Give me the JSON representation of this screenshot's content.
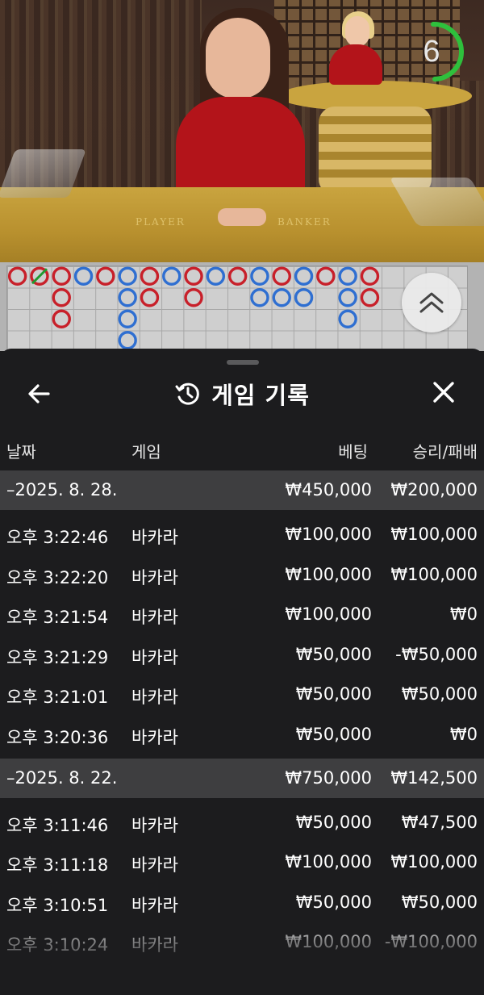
{
  "video": {
    "timer_value": "6",
    "table_labels": [
      "PLAYER",
      "BANKER"
    ]
  },
  "bead_road": {
    "colors": {
      "banker": "#c8202a",
      "player": "#2f6fd1",
      "tie": "#1f9a2f"
    },
    "columns": [
      [
        "banker"
      ],
      [
        "banker-tie"
      ],
      [
        "banker",
        "banker",
        "banker"
      ],
      [
        "player"
      ],
      [
        "banker"
      ],
      [
        "player",
        "player",
        "player",
        "player"
      ],
      [
        "banker",
        "banker"
      ],
      [
        "player"
      ],
      [
        "banker",
        "banker"
      ],
      [
        "player"
      ],
      [
        "banker"
      ],
      [
        "player",
        "player"
      ],
      [
        "banker",
        "player"
      ],
      [
        "player",
        "player"
      ],
      [
        "banker"
      ],
      [
        "player",
        "player",
        "player"
      ],
      [
        "banker",
        "banker"
      ]
    ]
  },
  "sheet": {
    "title": "게임 기록",
    "icons": {
      "back": "arrow-left-icon",
      "history": "history-clock-icon",
      "close": "close-icon",
      "expand": "chevron-double-up-icon"
    },
    "columns": {
      "date": "날짜",
      "game": "게임",
      "bet": "베팅",
      "result": "승리/패배"
    },
    "groups": [
      {
        "date": "–2025. 8. 28.",
        "total_bet": "₩450,000",
        "total_result": "₩200,000",
        "rows": [
          {
            "time": "오후 3:22:46",
            "game": "바카라",
            "bet": "₩100,000",
            "result": "₩100,000"
          },
          {
            "time": "오후 3:22:20",
            "game": "바카라",
            "bet": "₩100,000",
            "result": "₩100,000"
          },
          {
            "time": "오후 3:21:54",
            "game": "바카라",
            "bet": "₩100,000",
            "result": "₩0"
          },
          {
            "time": "오후 3:21:29",
            "game": "바카라",
            "bet": "₩50,000",
            "result": "-₩50,000"
          },
          {
            "time": "오후 3:21:01",
            "game": "바카라",
            "bet": "₩50,000",
            "result": "₩50,000"
          },
          {
            "time": "오후 3:20:36",
            "game": "바카라",
            "bet": "₩50,000",
            "result": "₩0"
          }
        ]
      },
      {
        "date": "–2025. 8. 22.",
        "total_bet": "₩750,000",
        "total_result": "₩142,500",
        "rows": [
          {
            "time": "오후 3:11:46",
            "game": "바카라",
            "bet": "₩50,000",
            "result": "₩47,500"
          },
          {
            "time": "오후 3:11:18",
            "game": "바카라",
            "bet": "₩100,000",
            "result": "₩100,000"
          },
          {
            "time": "오후 3:10:51",
            "game": "바카라",
            "bet": "₩50,000",
            "result": "₩50,000"
          },
          {
            "time": "오후 3:10:24",
            "game": "바카라",
            "bet": "₩100,000",
            "result": "-₩100,000"
          }
        ]
      }
    ]
  }
}
